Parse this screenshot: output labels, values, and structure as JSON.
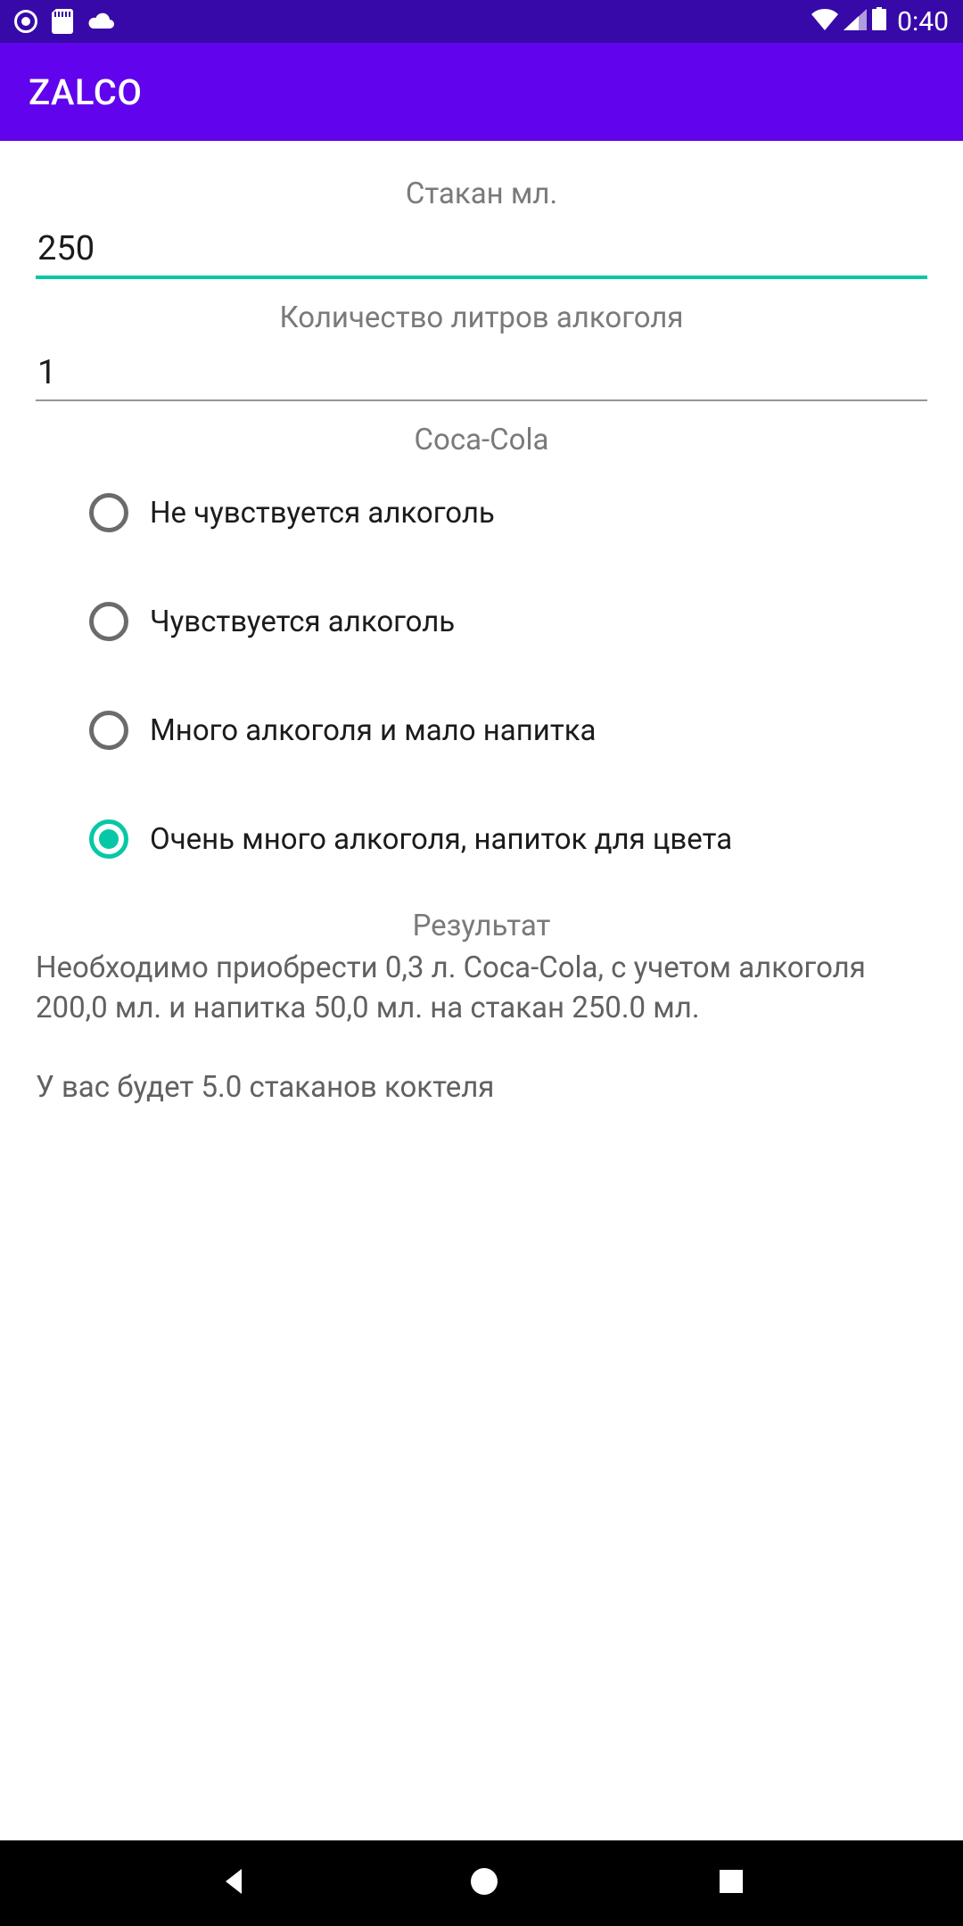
{
  "status": {
    "time": "0:40"
  },
  "app": {
    "title": "ZALCO"
  },
  "fields": {
    "glass": {
      "label": "Стакан мл.",
      "value": "250"
    },
    "liters": {
      "label": "Количество литров алкоголя",
      "value": "1"
    }
  },
  "drink": {
    "label": "Coca-Cola",
    "options": [
      "Не чувствуется алкоголь",
      "Чувствуется алкоголь",
      "Много алкоголя и мало напитка",
      "Очень много алкоголя, напиток для цвета"
    ],
    "selectedIndex": 3
  },
  "result": {
    "label": "Результат",
    "text": "Необходимо приобрести 0,3 л. Coca-Cola, с учетом алкоголя 200,0 мл. и напитка 50,0 мл. на стакан 250.0 мл.\n\nУ вас будет 5.0 стаканов коктеля"
  },
  "colors": {
    "accent": "#06c8a6",
    "primary": "#6103ed",
    "statusBar": "#3709a8"
  }
}
